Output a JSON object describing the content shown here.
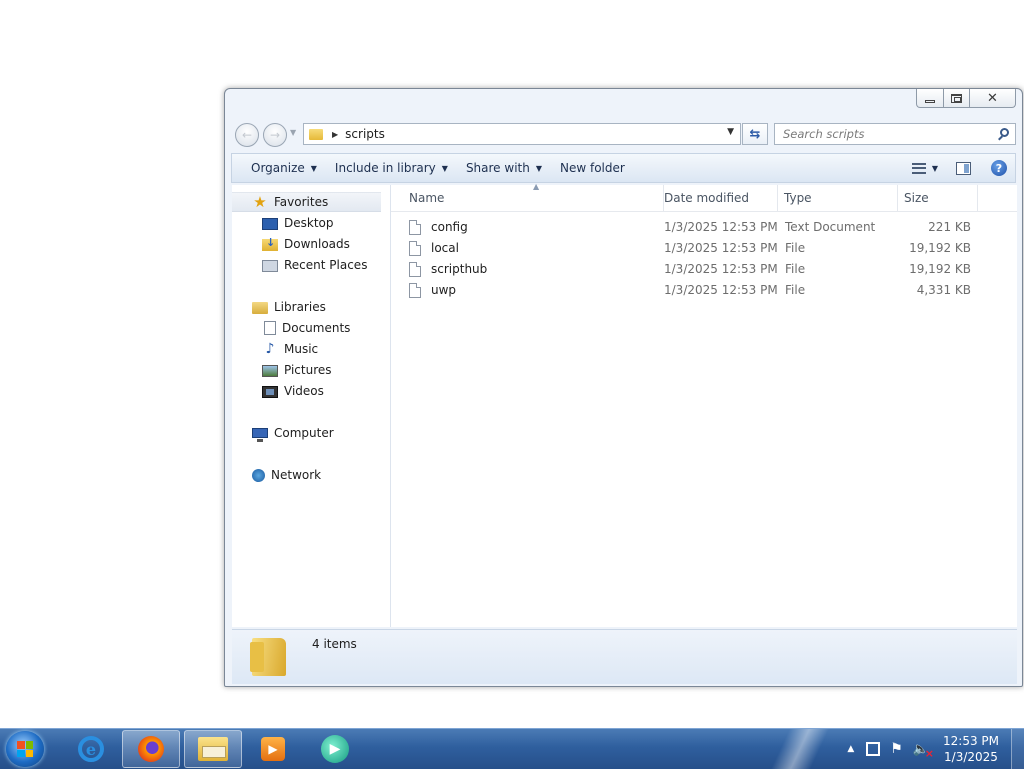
{
  "navbar": {
    "address_text": "scripts",
    "search_placeholder": "Search scripts"
  },
  "toolbar": {
    "organize": "Organize",
    "include_in_library": "Include in library",
    "share_with": "Share with",
    "new_folder": "New folder"
  },
  "nav_pane": {
    "favorites": "Favorites",
    "desktop": "Desktop",
    "downloads": "Downloads",
    "recent_places": "Recent Places",
    "libraries": "Libraries",
    "documents": "Documents",
    "music": "Music",
    "pictures": "Pictures",
    "videos": "Videos",
    "computer": "Computer",
    "network": "Network"
  },
  "columns": {
    "name": "Name",
    "date_modified": "Date modified",
    "type": "Type",
    "size": "Size"
  },
  "files": [
    {
      "name": "config",
      "date": "1/3/2025 12:53 PM",
      "type": "Text Document",
      "size": "221 KB"
    },
    {
      "name": "local",
      "date": "1/3/2025 12:53 PM",
      "type": "File",
      "size": "19,192 KB"
    },
    {
      "name": "scripthub",
      "date": "1/3/2025 12:53 PM",
      "type": "File",
      "size": "19,192 KB"
    },
    {
      "name": "uwp",
      "date": "1/3/2025 12:53 PM",
      "type": "File",
      "size": "4,331 KB"
    }
  ],
  "details": {
    "item_count": "4 items"
  },
  "taskbar": {
    "clock_time": "12:53 PM",
    "clock_date": "1/3/2025"
  }
}
